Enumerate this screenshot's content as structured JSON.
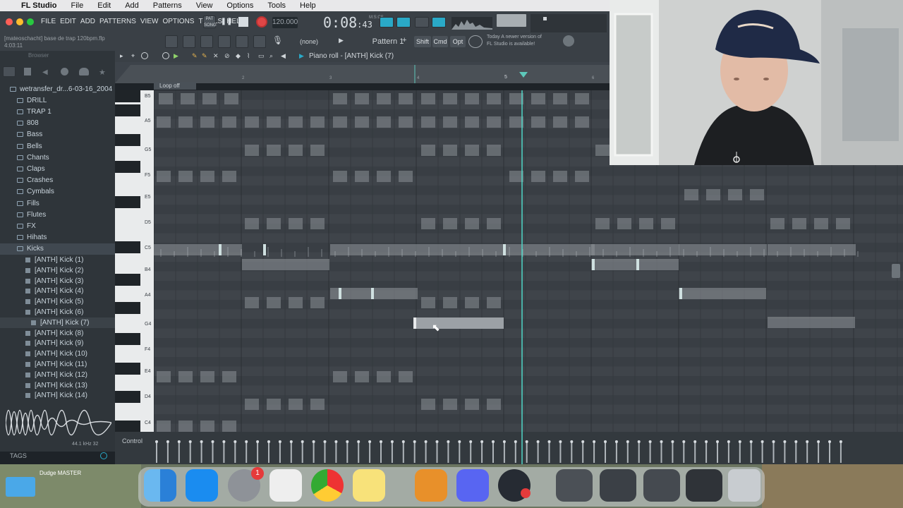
{
  "menubar": {
    "app": "FL Studio",
    "items": [
      "File",
      "Edit",
      "Add",
      "Patterns",
      "View",
      "Options",
      "Tools",
      "Help"
    ]
  },
  "topbar": {
    "menu": [
      "FILE",
      "EDIT",
      "ADD",
      "PATTERNS",
      "VIEW",
      "OPTIONS",
      "TOOLS",
      "HELP"
    ],
    "project_name": "[mateoschacht] base de trap 120bpm.flp",
    "project_time": "4:03:11",
    "tempo": "120.000",
    "time": "0:08",
    "time_sub": ":43",
    "time_unit": "M:S:CS",
    "pattern": "Pattern 1",
    "none_label": "(none)",
    "shift": "Shift",
    "cmd": "Cmd",
    "opt": "Opt",
    "news": [
      "Today  A newer version of",
      "FL Studio is available!"
    ],
    "pat_label": "PAT",
    "song_label": "SONG"
  },
  "sidebar": {
    "header": "Browser",
    "items": [
      {
        "label": "wetransfer_dr...6-03-16_2004",
        "level": 0,
        "type": "folder"
      },
      {
        "label": "DRILL",
        "level": 1,
        "type": "folder"
      },
      {
        "label": "TRAP 1",
        "level": 1,
        "type": "folder"
      },
      {
        "label": "808",
        "level": 2,
        "type": "folder"
      },
      {
        "label": "Bass",
        "level": 2,
        "type": "folder"
      },
      {
        "label": "Bells",
        "level": 2,
        "type": "folder"
      },
      {
        "label": "Chants",
        "level": 2,
        "type": "folder"
      },
      {
        "label": "Claps",
        "level": 2,
        "type": "folder"
      },
      {
        "label": "Crashes",
        "level": 2,
        "type": "folder"
      },
      {
        "label": "Cymbals",
        "level": 2,
        "type": "folder"
      },
      {
        "label": "Fills",
        "level": 2,
        "type": "folder"
      },
      {
        "label": "Flutes",
        "level": 2,
        "type": "folder"
      },
      {
        "label": "FX",
        "level": 2,
        "type": "folder"
      },
      {
        "label": "Hihats",
        "level": 2,
        "type": "folder"
      },
      {
        "label": "Kicks",
        "level": 2,
        "type": "folder"
      },
      {
        "label": "[ANTH] Kick (1)",
        "level": 3,
        "type": "file"
      },
      {
        "label": "[ANTH] Kick (2)",
        "level": 3,
        "type": "file"
      },
      {
        "label": "[ANTH] Kick (3)",
        "level": 3,
        "type": "file"
      },
      {
        "label": "[ANTH] Kick (4)",
        "level": 3,
        "type": "file"
      },
      {
        "label": "[ANTH] Kick (5)",
        "level": 3,
        "type": "file"
      },
      {
        "label": "[ANTH] Kick (6)",
        "level": 3,
        "type": "file"
      },
      {
        "label": "[ANTH] Kick (7)",
        "level": 3,
        "type": "file",
        "selected": true
      },
      {
        "label": "[ANTH] Kick (8)",
        "level": 3,
        "type": "file"
      },
      {
        "label": "[ANTH] Kick (9)",
        "level": 3,
        "type": "file"
      },
      {
        "label": "[ANTH] Kick (10)",
        "level": 3,
        "type": "file"
      },
      {
        "label": "[ANTH] Kick (11)",
        "level": 3,
        "type": "file"
      },
      {
        "label": "[ANTH] Kick (12)",
        "level": 3,
        "type": "file"
      },
      {
        "label": "[ANTH] Kick (13)",
        "level": 3,
        "type": "file"
      },
      {
        "label": "[ANTH] Kick (14)",
        "level": 3,
        "type": "file"
      }
    ],
    "sample_rate": "44.1 kHz 32",
    "tags": "TAGS"
  },
  "pianoroll": {
    "title": "Piano roll - [ANTH] Kick (7)",
    "loop": "Loop off",
    "bars": [
      "2",
      "3",
      "4",
      "5",
      "6"
    ],
    "keys": [
      "B5",
      "A5",
      "G5",
      "F5",
      "E5",
      "D5",
      "C5",
      "B4",
      "A4",
      "G4",
      "F4",
      "E4",
      "D4",
      "C4"
    ],
    "control": "Control"
  },
  "dock": {
    "desktop": "Dudge MASTER",
    "badge": "1"
  },
  "colors": {
    "note": "#8a8f95",
    "note_active": "#9ca1a6",
    "playhead": "#4fd6c6",
    "grid": "#3a3f45"
  }
}
